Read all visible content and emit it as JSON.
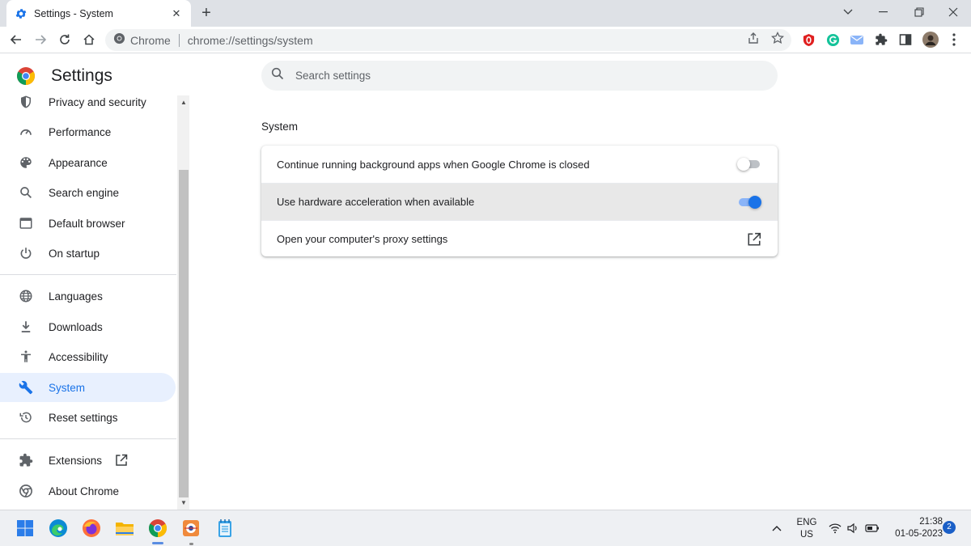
{
  "browser": {
    "tab_title": "Settings - System",
    "site_name": "Chrome",
    "url": "chrome://settings/system"
  },
  "settings": {
    "title": "Settings",
    "search_placeholder": "Search settings"
  },
  "sidebar": {
    "items": [
      {
        "label": "Privacy and security",
        "icon": "shield-icon"
      },
      {
        "label": "Performance",
        "icon": "speedometer-icon"
      },
      {
        "label": "Appearance",
        "icon": "palette-icon"
      },
      {
        "label": "Search engine",
        "icon": "search-icon"
      },
      {
        "label": "Default browser",
        "icon": "browser-window-icon"
      },
      {
        "label": "On startup",
        "icon": "power-icon"
      },
      {
        "label": "Languages",
        "icon": "globe-icon"
      },
      {
        "label": "Downloads",
        "icon": "download-icon"
      },
      {
        "label": "Accessibility",
        "icon": "accessibility-icon"
      },
      {
        "label": "System",
        "icon": "wrench-icon",
        "active": true
      },
      {
        "label": "Reset settings",
        "icon": "restore-icon"
      },
      {
        "label": "Extensions",
        "icon": "puzzle-icon"
      },
      {
        "label": "About Chrome",
        "icon": "chrome-icon"
      }
    ]
  },
  "system": {
    "section_title": "System",
    "rows": [
      {
        "label": "Continue running background apps when Google Chrome is closed",
        "control": "toggle",
        "on": false
      },
      {
        "label": "Use hardware acceleration when available",
        "control": "toggle",
        "on": true
      },
      {
        "label": "Open your computer's proxy settings",
        "control": "external-link"
      }
    ]
  },
  "taskbar": {
    "language_line1": "ENG",
    "language_line2": "US",
    "time": "21:38",
    "date": "01-05-2023",
    "notification_count": "2"
  },
  "colors": {
    "accent": "#1a73e8",
    "active_nav_bg": "#e8f0fe",
    "toggle_on_track": "#8ab4f8",
    "tabstrip_bg": "#dee1e6"
  }
}
